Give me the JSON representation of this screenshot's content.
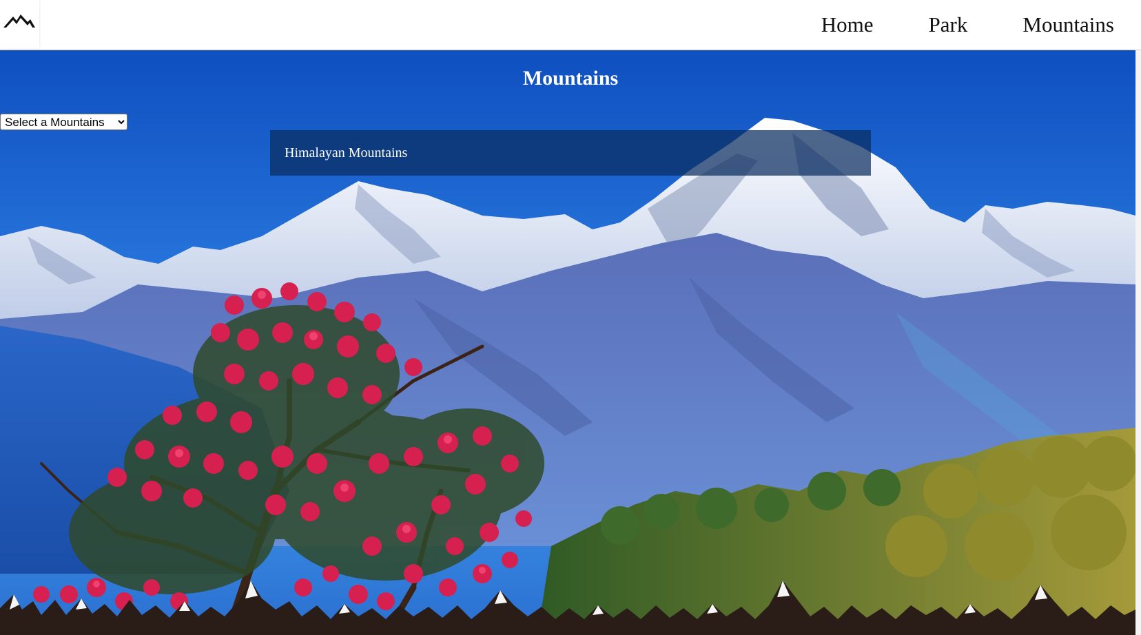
{
  "header": {
    "logo_icon": "mountain-logo-icon",
    "nav": [
      {
        "label": "Home"
      },
      {
        "label": "Park"
      },
      {
        "label": "Mountains"
      }
    ]
  },
  "main": {
    "title": "Mountains",
    "select": {
      "selected": "Select a Mountains"
    },
    "info_box": {
      "text": "Himalayan Mountains"
    },
    "background_image": "himalayan-mountains-photo",
    "footer_decoration": "snowy-peaks-border"
  },
  "colors": {
    "sky": "#1a5fc8",
    "snow": "#f2f4f8",
    "flowers": "#d6204f",
    "forest": "#6d8a2a",
    "footer_band": "#2a1d17"
  }
}
